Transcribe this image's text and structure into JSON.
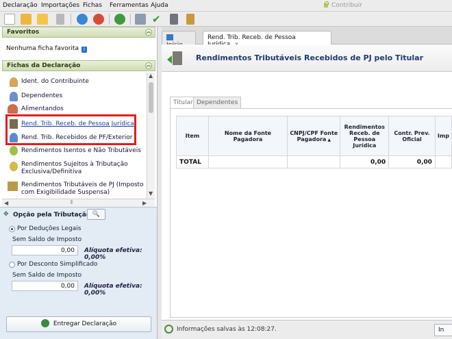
{
  "menu": [
    "Declaração",
    "Importações",
    "Fichas",
    "Ferramentas",
    "Ajuda"
  ],
  "contribuir": "Contribuir",
  "left": {
    "favoritos_title": "Favoritos",
    "favoritos_empty": "Nenhuma ficha favorita",
    "fichas_title": "Fichas da Declaração",
    "fichas": [
      "Ident. do Contribuinte",
      "Dependentes",
      "Alimentandos",
      "Rend. Trib. Receb. de Pessoa Jurídica",
      "Rend. Trib. Recebidos de PF/Exterior",
      "Rendimentos Isentos e Não Tributáveis",
      "Rendimentos Sujeitos à Tributação",
      "Exclusiva/Definitiva",
      "Rendimentos Tributáveis de PJ (Imposto",
      "com Exigibilidade Suspensa)"
    ],
    "opcao_title": "Opção pela Tributação:",
    "opt1_label": "Por Deduções Legais",
    "opt1_sub": "Sem Saldo de Imposto",
    "opt1_value": "0,00",
    "opt1_aliq": "Alíquota efetiva: 0,00%",
    "opt2_label": "Por Desconto Simplificado",
    "opt2_sub": "Sem Saldo de Imposto",
    "opt2_value": "0,00",
    "opt2_aliq": "Alíquota efetiva: 0,00%",
    "entregar": "Entregar Declaração"
  },
  "right": {
    "tab_inicio": "Início",
    "tab_active": "Rend. Trib. Receb. de Pessoa Jurídica",
    "tab_close": "×",
    "title": "Rendimentos Tributáveis Recebidos de PJ pelo Titular",
    "subtab_titular": "Titular",
    "subtab_dependentes": "Dependentes",
    "columns": [
      "Item",
      "Nome da Fonte Pagadora",
      "CNPJ/CPF Fonte Pagadora",
      "Rendimentos Receb. de Pessoa Jurídica",
      "Contr. Prev. Oficial",
      "Imp"
    ],
    "total_label": "TOTAL",
    "total_rend": "0,00",
    "total_contr": "0,00",
    "status": "Informações salvas às 12:08:27.",
    "bottom_btn": "In"
  },
  "colors": {
    "highlight": "#e11d1d",
    "link": "#1a3f9a",
    "title": "#1f3a72"
  }
}
